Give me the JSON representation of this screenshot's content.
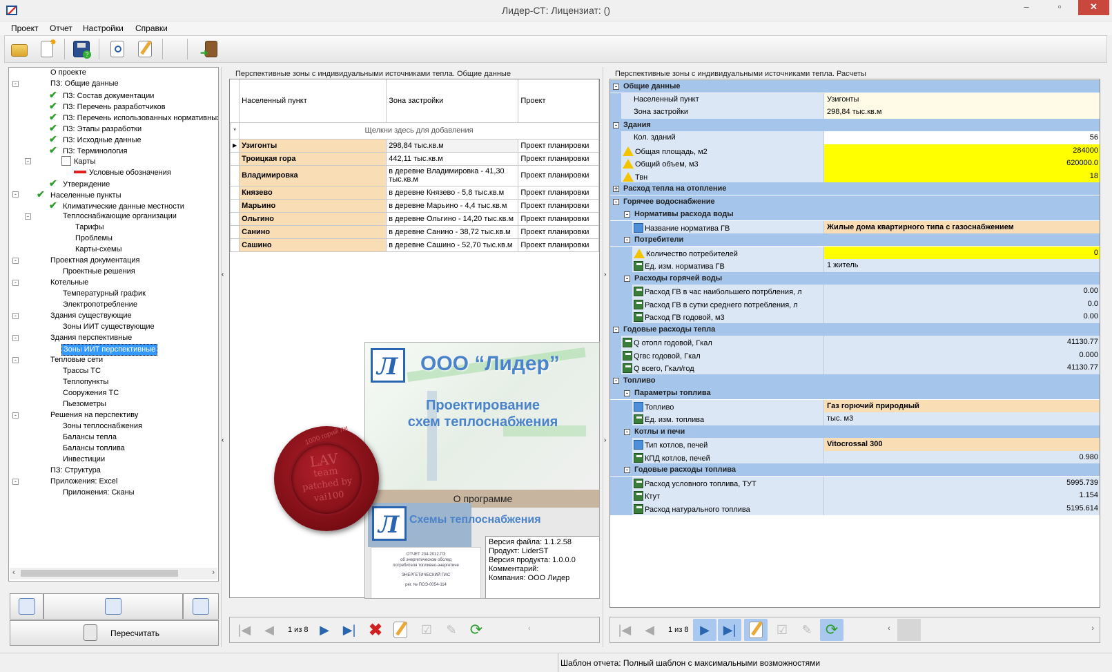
{
  "window": {
    "title": "Лидер-СТ:  Лицензиат: ()",
    "minimize": "–",
    "restore": "▫",
    "close": "✕"
  },
  "menu": [
    "Проект",
    "Отчет",
    "Настройки",
    "Справки"
  ],
  "toolbar": {
    "icons": [
      "open-folder-icon",
      "new-document-icon",
      "save-icon",
      "preview-icon",
      "edit-icon",
      "exit-icon"
    ]
  },
  "tree": {
    "items": [
      {
        "label": "О проекте",
        "level": 1,
        "check": false,
        "expander": ""
      },
      {
        "label": "ПЗ: Общие данные",
        "level": 1,
        "check": false,
        "expander": "-"
      },
      {
        "label": "ПЗ: Состав документации",
        "level": 2,
        "check": true,
        "expander": ""
      },
      {
        "label": "ПЗ: Перечень разработчиков",
        "level": 2,
        "check": true,
        "expander": ""
      },
      {
        "label": "ПЗ: Перечень использованных нормативных до",
        "level": 2,
        "check": true,
        "expander": ""
      },
      {
        "label": "ПЗ: Этапы разработки",
        "level": 2,
        "check": true,
        "expander": ""
      },
      {
        "label": "ПЗ: Исходные данные",
        "level": 2,
        "check": true,
        "expander": ""
      },
      {
        "label": "ПЗ: Терминология",
        "level": 2,
        "check": true,
        "expander": ""
      },
      {
        "label": "Карты",
        "level": 2,
        "check": false,
        "expander": "-",
        "icon": "map-doc-icon"
      },
      {
        "label": "Условные обозначения",
        "level": 3,
        "check": false,
        "expander": "",
        "icon": "legend-icon"
      },
      {
        "label": "Утверждение",
        "level": 2,
        "check": true,
        "expander": ""
      },
      {
        "label": "Населенные пункты",
        "level": 1,
        "check": true,
        "expander": "-"
      },
      {
        "label": "Климатические данные местности",
        "level": 2,
        "check": true,
        "expander": ""
      },
      {
        "label": "Теплоснабжающие организации",
        "level": 2,
        "check": false,
        "expander": "-"
      },
      {
        "label": "Тарифы",
        "level": 3,
        "check": false,
        "expander": ""
      },
      {
        "label": "Проблемы",
        "level": 3,
        "check": false,
        "expander": ""
      },
      {
        "label": "Карты-схемы",
        "level": 3,
        "check": false,
        "expander": ""
      },
      {
        "label": "Проектная документация",
        "level": 1,
        "check": false,
        "expander": "-"
      },
      {
        "label": "Проектные решения",
        "level": 2,
        "check": false,
        "expander": ""
      },
      {
        "label": "Котельные",
        "level": 1,
        "check": false,
        "expander": "-"
      },
      {
        "label": "Температурный график",
        "level": 2,
        "check": false,
        "expander": ""
      },
      {
        "label": "Электропотребление",
        "level": 2,
        "check": false,
        "expander": ""
      },
      {
        "label": "Здания существующие",
        "level": 1,
        "check": false,
        "expander": "-"
      },
      {
        "label": "Зоны ИИТ существующие",
        "level": 2,
        "check": false,
        "expander": ""
      },
      {
        "label": "Здания перспективные",
        "level": 1,
        "check": false,
        "expander": "-"
      },
      {
        "label": "Зоны ИИТ перспективные",
        "level": 2,
        "check": false,
        "expander": "",
        "selected": true
      },
      {
        "label": "Тепловые сети",
        "level": 1,
        "check": false,
        "expander": "-"
      },
      {
        "label": "Трассы ТС",
        "level": 2,
        "check": false,
        "expander": ""
      },
      {
        "label": "Теплопункты",
        "level": 2,
        "check": false,
        "expander": ""
      },
      {
        "label": "Сооружения ТС",
        "level": 2,
        "check": false,
        "expander": ""
      },
      {
        "label": "Пьезометры",
        "level": 2,
        "check": false,
        "expander": ""
      },
      {
        "label": "Решения на перспективу",
        "level": 1,
        "check": false,
        "expander": "-"
      },
      {
        "label": "Зоны теплоснабжения",
        "level": 2,
        "check": false,
        "expander": ""
      },
      {
        "label": "Балансы тепла",
        "level": 2,
        "check": false,
        "expander": ""
      },
      {
        "label": "Балансы топлива",
        "level": 2,
        "check": false,
        "expander": ""
      },
      {
        "label": "Инвестиции",
        "level": 2,
        "check": false,
        "expander": ""
      },
      {
        "label": "ПЗ: Структура",
        "level": 1,
        "check": false,
        "expander": ""
      },
      {
        "label": "Приложения: Excel",
        "level": 1,
        "check": false,
        "expander": "-"
      },
      {
        "label": "Приложения: Сканы",
        "level": 2,
        "check": false,
        "expander": ""
      }
    ],
    "recalc_label": "Пересчитать"
  },
  "grid_panel": {
    "title": "Перспективные зоны с индивидуальными источниками тепла. Общие данные",
    "columns": [
      "Населенный пункт",
      "Зона застройки",
      "Проект"
    ],
    "new_row_hint": "Щелкни здесь для добавления",
    "rows": [
      [
        "Узигонты",
        "298,84 тыс.кв.м",
        "Проект планировки"
      ],
      [
        "Троицкая гора",
        "442,11 тыс.кв.м",
        "Проект планировки"
      ],
      [
        "Владимировка",
        "в деревне Владимировка - 41,30 тыс.кв.м",
        "Проект планировки"
      ],
      [
        "Князево",
        "в деревне Князево - 5,8 тыс.кв.м",
        "Проект планировки"
      ],
      [
        "Марьино",
        "в деревне Марьино - 4,4 тыс.кв.м",
        "Проект планировки"
      ],
      [
        "Ольгино",
        " в деревне Ольгино - 14,20 тыс.кв.м",
        "Проект планировки"
      ],
      [
        "Санино",
        "в деревне Санино - 38,72 тыс.кв.м",
        "Проект планировки"
      ],
      [
        "Сашино",
        "в деревне Сашино - 52,70 тыс.кв.м",
        "Проект планировки"
      ]
    ],
    "pager": "1 из 8"
  },
  "splash": {
    "company": "ООО “Лидер”",
    "subtitle1": "Проектирование",
    "subtitle2": "схем теплоснабжения",
    "about": "О программе",
    "product_banner": "Схемы теплоснабжения",
    "doc_lines": [
      "ОТЧЕТ 234-2012.ПЗ",
      "об энергетическом обслед",
      "потребителя топливно-энергетиче",
      "ЭНЕРГЕТИЧЕСКИЙ ПАС",
      "рег. № ПОЭ-0054-114"
    ],
    "info": [
      "Версия файла: 1.1.2.58",
      "Продукт: LiderST",
      "Версия продукта: 1.0.0.0",
      "Комментарий:",
      "Компания: ООО Лидер"
    ]
  },
  "seal": {
    "lines": [
      "LAV",
      "team",
      "patched by",
      "vai100"
    ],
    "arc": "1000 горий ли"
  },
  "prop_panel": {
    "title": "Перспективные зоны с индивидуальными источниками тепла. Расчеты",
    "pager": "1 из 8",
    "rows": [
      {
        "type": "cat",
        "level": 0,
        "label": "Общие данные",
        "exp": "-"
      },
      {
        "type": "prop",
        "level": 1,
        "label": "Населенный пункт",
        "value": "Узигонты",
        "style": "cream",
        "icon": ""
      },
      {
        "type": "prop",
        "level": 1,
        "label": "Зона застройки",
        "value": "298,84 тыс.кв.м",
        "style": "cream",
        "icon": ""
      },
      {
        "type": "cat",
        "level": 0,
        "label": "Здания",
        "exp": "-"
      },
      {
        "type": "prop",
        "level": 1,
        "label": "Кол. зданий",
        "value": "56",
        "style": "white right",
        "icon": ""
      },
      {
        "type": "prop",
        "level": 1,
        "label": "Общая площадь, м2",
        "value": "284000",
        "style": "yellow right",
        "icon": "warn"
      },
      {
        "type": "prop",
        "level": 1,
        "label": "Общий объем, м3",
        "value": "620000.0",
        "style": "yellow right",
        "icon": "warn"
      },
      {
        "type": "prop",
        "level": 1,
        "label": "Твн",
        "value": "18",
        "style": "yellow right",
        "icon": "warn"
      },
      {
        "type": "cat",
        "level": 0,
        "label": "Расход тепла на отопление",
        "exp": "+"
      },
      {
        "type": "cat",
        "level": 0,
        "label": "Горячее водоснабжение",
        "exp": "-"
      },
      {
        "type": "cat",
        "level": 1,
        "label": "Нормативы расхода воды",
        "exp": "-"
      },
      {
        "type": "prop",
        "level": 2,
        "label": "Название норматива ГВ",
        "value": "Жилые дома квартирного типа с газоснабжением",
        "style": "tan",
        "icon": "list"
      },
      {
        "type": "cat",
        "level": 1,
        "label": "Потребители",
        "exp": "-"
      },
      {
        "type": "prop",
        "level": 2,
        "label": "Количество потребителей",
        "value": "0",
        "style": "yellow right",
        "icon": "warn"
      },
      {
        "type": "prop",
        "level": 2,
        "label": "Ед. изм. норматива ГВ",
        "value": "1 житель",
        "style": "lblue",
        "icon": "calc"
      },
      {
        "type": "cat",
        "level": 1,
        "label": "Расходы горячей воды",
        "exp": "-"
      },
      {
        "type": "prop",
        "level": 2,
        "label": "Расход ГВ в час наибольшего потрбления, л",
        "value": "0.00",
        "style": "lblue right",
        "icon": "calc"
      },
      {
        "type": "prop",
        "level": 2,
        "label": "Расход ГВ в сутки среднего потребления, л",
        "value": "0.0",
        "style": "lblue right",
        "icon": "calc"
      },
      {
        "type": "prop",
        "level": 2,
        "label": "Расход ГВ годовой, м3",
        "value": "0.00",
        "style": "lblue right",
        "icon": "calc"
      },
      {
        "type": "cat",
        "level": 0,
        "label": "Годовые расходы тепла",
        "exp": "-"
      },
      {
        "type": "prop",
        "level": 1,
        "label": "Q отопл годовой, Гкал",
        "value": "41130.77",
        "style": "lblue right",
        "icon": "calc"
      },
      {
        "type": "prop",
        "level": 1,
        "label": "Qгвс годовой, Гкал",
        "value": "0.000",
        "style": "lblue right",
        "icon": "calc"
      },
      {
        "type": "prop",
        "level": 1,
        "label": "Q всего, Гкал/год",
        "value": "41130.77",
        "style": "lblue right",
        "icon": "calc"
      },
      {
        "type": "cat",
        "level": 0,
        "label": "Топливо",
        "exp": "-"
      },
      {
        "type": "cat",
        "level": 1,
        "label": "Параметры топлива",
        "exp": "-"
      },
      {
        "type": "prop",
        "level": 2,
        "label": "Топливо",
        "value": "Газ горючий природный",
        "style": "tan",
        "icon": "list"
      },
      {
        "type": "prop",
        "level": 2,
        "label": "Ед. изм. топлива",
        "value": "тыс. м3",
        "style": "lblue",
        "icon": "calc"
      },
      {
        "type": "cat",
        "level": 1,
        "label": "Котлы и печи",
        "exp": "-"
      },
      {
        "type": "prop",
        "level": 2,
        "label": "Тип котлов, печей",
        "value": "Vitocrossal 300",
        "style": "tan",
        "icon": "list"
      },
      {
        "type": "prop",
        "level": 2,
        "label": "КПД котлов, печей",
        "value": "0.980",
        "style": "lblue right",
        "icon": "calc"
      },
      {
        "type": "cat",
        "level": 1,
        "label": "Годовые расходы топлива",
        "exp": "-"
      },
      {
        "type": "prop",
        "level": 2,
        "label": "Расход условного топлива, ТУТ",
        "value": "5995.739",
        "style": "lblue right",
        "icon": "calc"
      },
      {
        "type": "prop",
        "level": 2,
        "label": "Ктут",
        "value": "1.154",
        "style": "lblue right",
        "icon": "calc"
      },
      {
        "type": "prop",
        "level": 2,
        "label": "Расход натурального топлива",
        "value": "5195.614",
        "style": "lblue right",
        "icon": "calc"
      }
    ]
  },
  "status": {
    "template": "Шаблон отчета: Полный шаблон с максимальными возможностями"
  },
  "colors": {
    "category": "#a5c5ea",
    "name_cell": "#f9ddb5",
    "warning_value": "#ffff00",
    "selection": "#3399ff"
  }
}
